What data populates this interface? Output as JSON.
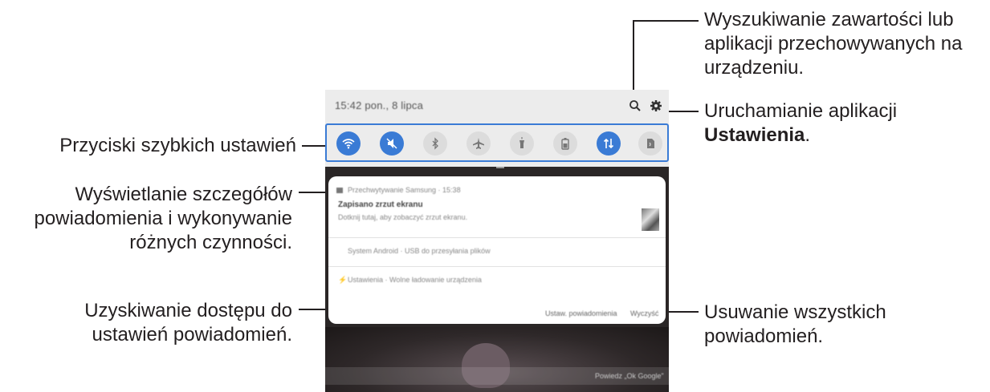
{
  "callouts": {
    "search": "Wyszukiwanie zawartości lub aplikacji przechowywanych na urządzeniu.",
    "settings_pre": "Uruchamianie aplikacji",
    "settings_bold": "Ustawienia",
    "settings_post": ".",
    "quick_settings": "Przyciski szybkich ustawień",
    "notification_details": "Wyświetlanie szczegółów powiadomienia i wykonywanie różnych czynności.",
    "notification_settings": "Uzyskiwanie dostępu do ustawień powiadomień.",
    "clear_all": "Usuwanie wszystkich powiadomień."
  },
  "panel": {
    "status_time": "15:42 pon., 8 lipca",
    "toggles": [
      {
        "name": "wifi-toggle",
        "state": "on"
      },
      {
        "name": "sound-toggle",
        "state": "on"
      },
      {
        "name": "bluetooth-toggle",
        "state": "off"
      },
      {
        "name": "airplane-toggle",
        "state": "off"
      },
      {
        "name": "flashlight-toggle",
        "state": "off"
      },
      {
        "name": "battery-saver-toggle",
        "state": "off"
      },
      {
        "name": "mobile-data-toggle",
        "state": "on"
      },
      {
        "name": "nfc-toggle",
        "state": "off"
      }
    ],
    "notifications": [
      {
        "app": "Przechwytywanie Samsung · 15:38",
        "title": "Zapisano zrzut ekranu",
        "text": "Dotknij tutaj, aby zobaczyć zrzut ekranu."
      },
      {
        "app": "System Android · USB do przesyłania plików"
      },
      {
        "app": "Ustawienia · Wolne ładowanie urządzenia"
      }
    ],
    "notification_settings_label": "Ustaw. powiadomienia",
    "clear_label": "Wyczyść",
    "google_hint": "Powiedz „Ok Google”"
  },
  "colors": {
    "accent": "#3a7bd5",
    "callout_text": "#231f20"
  }
}
